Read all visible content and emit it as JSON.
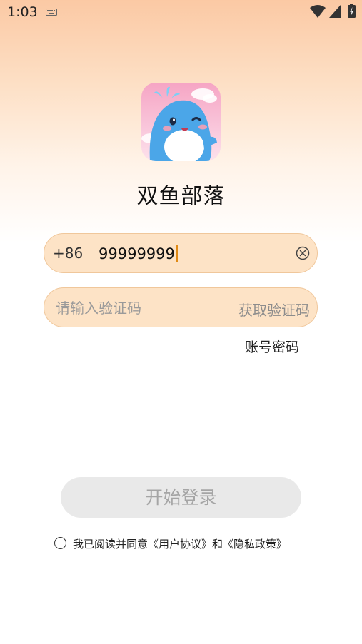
{
  "status_bar": {
    "time": "1:03"
  },
  "app": {
    "name": "双鱼部落"
  },
  "phone": {
    "country_code": "+86",
    "value": "99999999"
  },
  "code": {
    "placeholder": "请输入验证码",
    "get_code_label": "获取验证码"
  },
  "alt_login_label": "账号密码",
  "login_button_label": "开始登录",
  "agreement": {
    "text": "我已阅读并同意《用户协议》和《隐私政策》"
  },
  "colors": {
    "field_bg": "#fde3c6",
    "caret": "#e08a14",
    "button_disabled_bg": "#e9e9e9"
  }
}
